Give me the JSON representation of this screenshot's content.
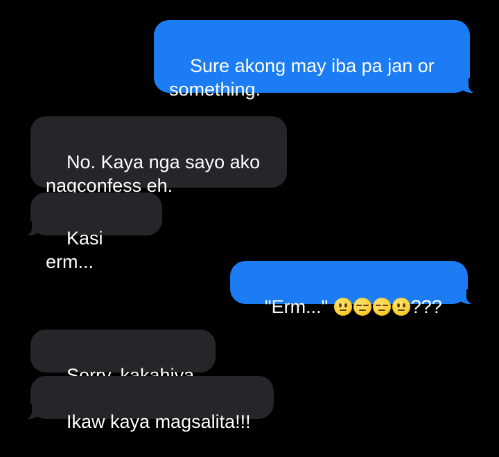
{
  "conversation": {
    "messages": [
      {
        "direction": "sent",
        "text": "Sure akong may iba pa jan or something."
      },
      {
        "direction": "received",
        "text": "No. Kaya nga sayo ako nagconfess eh."
      },
      {
        "direction": "received",
        "text": "Kasi erm..."
      },
      {
        "direction": "sent",
        "text_prefix": "\"Erm...\" ",
        "emojis": [
          "neutral-face-icon",
          "expressionless-face-icon",
          "expressionless-face-icon",
          "neutral-face-icon"
        ],
        "text_suffix": "???"
      },
      {
        "direction": "received",
        "text": "Sorry, kakahiya."
      },
      {
        "direction": "received",
        "text": "Ikaw kaya magsalita!!!"
      }
    ]
  },
  "colors": {
    "background": "#000000",
    "sent_bubble": "#1b7cf4",
    "received_bubble": "#26252a",
    "text": "#ffffff"
  }
}
